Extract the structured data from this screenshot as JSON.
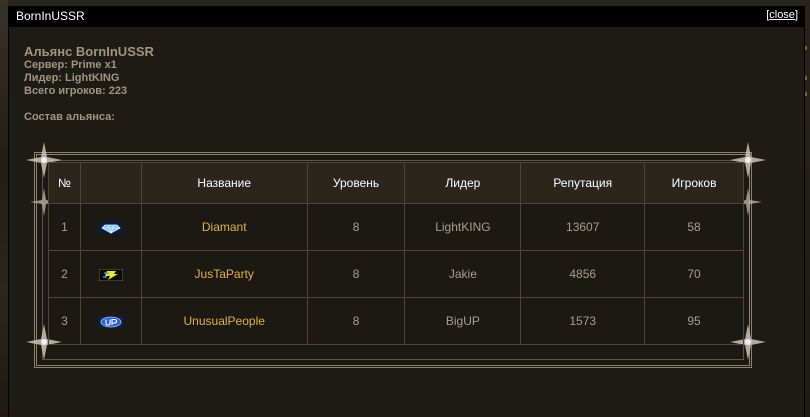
{
  "window": {
    "title": "BornInUSSR",
    "close_label": "close"
  },
  "alliance": {
    "heading": "Альянс BornInUSSR",
    "server": "Сервер: Prime x1",
    "leader": "Лидер: LightKING",
    "players": "Всего игроков: 223",
    "composition": "Состав альянса:"
  },
  "table": {
    "headers": {
      "num": "№",
      "name": "Название",
      "level": "Уровень",
      "leader": "Лидер",
      "reputation": "Репутация",
      "players": "Игроков"
    },
    "rows": [
      {
        "num": "1",
        "emblem": "diamond-emblem-icon",
        "name": "Diamant",
        "level": "8",
        "leader": "LightKING",
        "reputation": "13607",
        "players": "58"
      },
      {
        "num": "2",
        "emblem": "party-emblem-icon",
        "name": "JusTaParty",
        "level": "8",
        "leader": "Jakie",
        "reputation": "4856",
        "players": "70"
      },
      {
        "num": "3",
        "emblem": "up-emblem-icon",
        "name": "UnusualPeople",
        "level": "8",
        "leader": "BigUP",
        "reputation": "1573",
        "players": "95"
      }
    ]
  },
  "colors": {
    "clan_name": "#e0b14a",
    "cell_text": "#a79e8e",
    "header_bg": "#2b251e",
    "frame": "#8b8270"
  }
}
